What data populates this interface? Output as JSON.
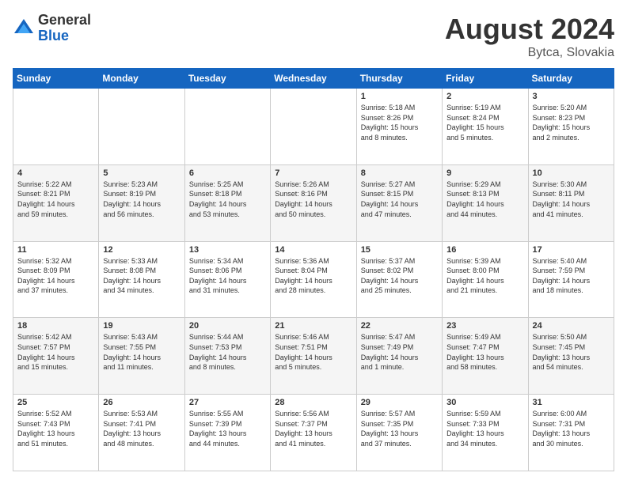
{
  "header": {
    "logo_general": "General",
    "logo_blue": "Blue",
    "month_year": "August 2024",
    "location": "Bytca, Slovakia"
  },
  "weekdays": [
    "Sunday",
    "Monday",
    "Tuesday",
    "Wednesday",
    "Thursday",
    "Friday",
    "Saturday"
  ],
  "weeks": [
    [
      {
        "day": "",
        "info": ""
      },
      {
        "day": "",
        "info": ""
      },
      {
        "day": "",
        "info": ""
      },
      {
        "day": "",
        "info": ""
      },
      {
        "day": "1",
        "info": "Sunrise: 5:18 AM\nSunset: 8:26 PM\nDaylight: 15 hours\nand 8 minutes."
      },
      {
        "day": "2",
        "info": "Sunrise: 5:19 AM\nSunset: 8:24 PM\nDaylight: 15 hours\nand 5 minutes."
      },
      {
        "day": "3",
        "info": "Sunrise: 5:20 AM\nSunset: 8:23 PM\nDaylight: 15 hours\nand 2 minutes."
      }
    ],
    [
      {
        "day": "4",
        "info": "Sunrise: 5:22 AM\nSunset: 8:21 PM\nDaylight: 14 hours\nand 59 minutes."
      },
      {
        "day": "5",
        "info": "Sunrise: 5:23 AM\nSunset: 8:19 PM\nDaylight: 14 hours\nand 56 minutes."
      },
      {
        "day": "6",
        "info": "Sunrise: 5:25 AM\nSunset: 8:18 PM\nDaylight: 14 hours\nand 53 minutes."
      },
      {
        "day": "7",
        "info": "Sunrise: 5:26 AM\nSunset: 8:16 PM\nDaylight: 14 hours\nand 50 minutes."
      },
      {
        "day": "8",
        "info": "Sunrise: 5:27 AM\nSunset: 8:15 PM\nDaylight: 14 hours\nand 47 minutes."
      },
      {
        "day": "9",
        "info": "Sunrise: 5:29 AM\nSunset: 8:13 PM\nDaylight: 14 hours\nand 44 minutes."
      },
      {
        "day": "10",
        "info": "Sunrise: 5:30 AM\nSunset: 8:11 PM\nDaylight: 14 hours\nand 41 minutes."
      }
    ],
    [
      {
        "day": "11",
        "info": "Sunrise: 5:32 AM\nSunset: 8:09 PM\nDaylight: 14 hours\nand 37 minutes."
      },
      {
        "day": "12",
        "info": "Sunrise: 5:33 AM\nSunset: 8:08 PM\nDaylight: 14 hours\nand 34 minutes."
      },
      {
        "day": "13",
        "info": "Sunrise: 5:34 AM\nSunset: 8:06 PM\nDaylight: 14 hours\nand 31 minutes."
      },
      {
        "day": "14",
        "info": "Sunrise: 5:36 AM\nSunset: 8:04 PM\nDaylight: 14 hours\nand 28 minutes."
      },
      {
        "day": "15",
        "info": "Sunrise: 5:37 AM\nSunset: 8:02 PM\nDaylight: 14 hours\nand 25 minutes."
      },
      {
        "day": "16",
        "info": "Sunrise: 5:39 AM\nSunset: 8:00 PM\nDaylight: 14 hours\nand 21 minutes."
      },
      {
        "day": "17",
        "info": "Sunrise: 5:40 AM\nSunset: 7:59 PM\nDaylight: 14 hours\nand 18 minutes."
      }
    ],
    [
      {
        "day": "18",
        "info": "Sunrise: 5:42 AM\nSunset: 7:57 PM\nDaylight: 14 hours\nand 15 minutes."
      },
      {
        "day": "19",
        "info": "Sunrise: 5:43 AM\nSunset: 7:55 PM\nDaylight: 14 hours\nand 11 minutes."
      },
      {
        "day": "20",
        "info": "Sunrise: 5:44 AM\nSunset: 7:53 PM\nDaylight: 14 hours\nand 8 minutes."
      },
      {
        "day": "21",
        "info": "Sunrise: 5:46 AM\nSunset: 7:51 PM\nDaylight: 14 hours\nand 5 minutes."
      },
      {
        "day": "22",
        "info": "Sunrise: 5:47 AM\nSunset: 7:49 PM\nDaylight: 14 hours\nand 1 minute."
      },
      {
        "day": "23",
        "info": "Sunrise: 5:49 AM\nSunset: 7:47 PM\nDaylight: 13 hours\nand 58 minutes."
      },
      {
        "day": "24",
        "info": "Sunrise: 5:50 AM\nSunset: 7:45 PM\nDaylight: 13 hours\nand 54 minutes."
      }
    ],
    [
      {
        "day": "25",
        "info": "Sunrise: 5:52 AM\nSunset: 7:43 PM\nDaylight: 13 hours\nand 51 minutes."
      },
      {
        "day": "26",
        "info": "Sunrise: 5:53 AM\nSunset: 7:41 PM\nDaylight: 13 hours\nand 48 minutes."
      },
      {
        "day": "27",
        "info": "Sunrise: 5:55 AM\nSunset: 7:39 PM\nDaylight: 13 hours\nand 44 minutes."
      },
      {
        "day": "28",
        "info": "Sunrise: 5:56 AM\nSunset: 7:37 PM\nDaylight: 13 hours\nand 41 minutes."
      },
      {
        "day": "29",
        "info": "Sunrise: 5:57 AM\nSunset: 7:35 PM\nDaylight: 13 hours\nand 37 minutes."
      },
      {
        "day": "30",
        "info": "Sunrise: 5:59 AM\nSunset: 7:33 PM\nDaylight: 13 hours\nand 34 minutes."
      },
      {
        "day": "31",
        "info": "Sunrise: 6:00 AM\nSunset: 7:31 PM\nDaylight: 13 hours\nand 30 minutes."
      }
    ]
  ]
}
